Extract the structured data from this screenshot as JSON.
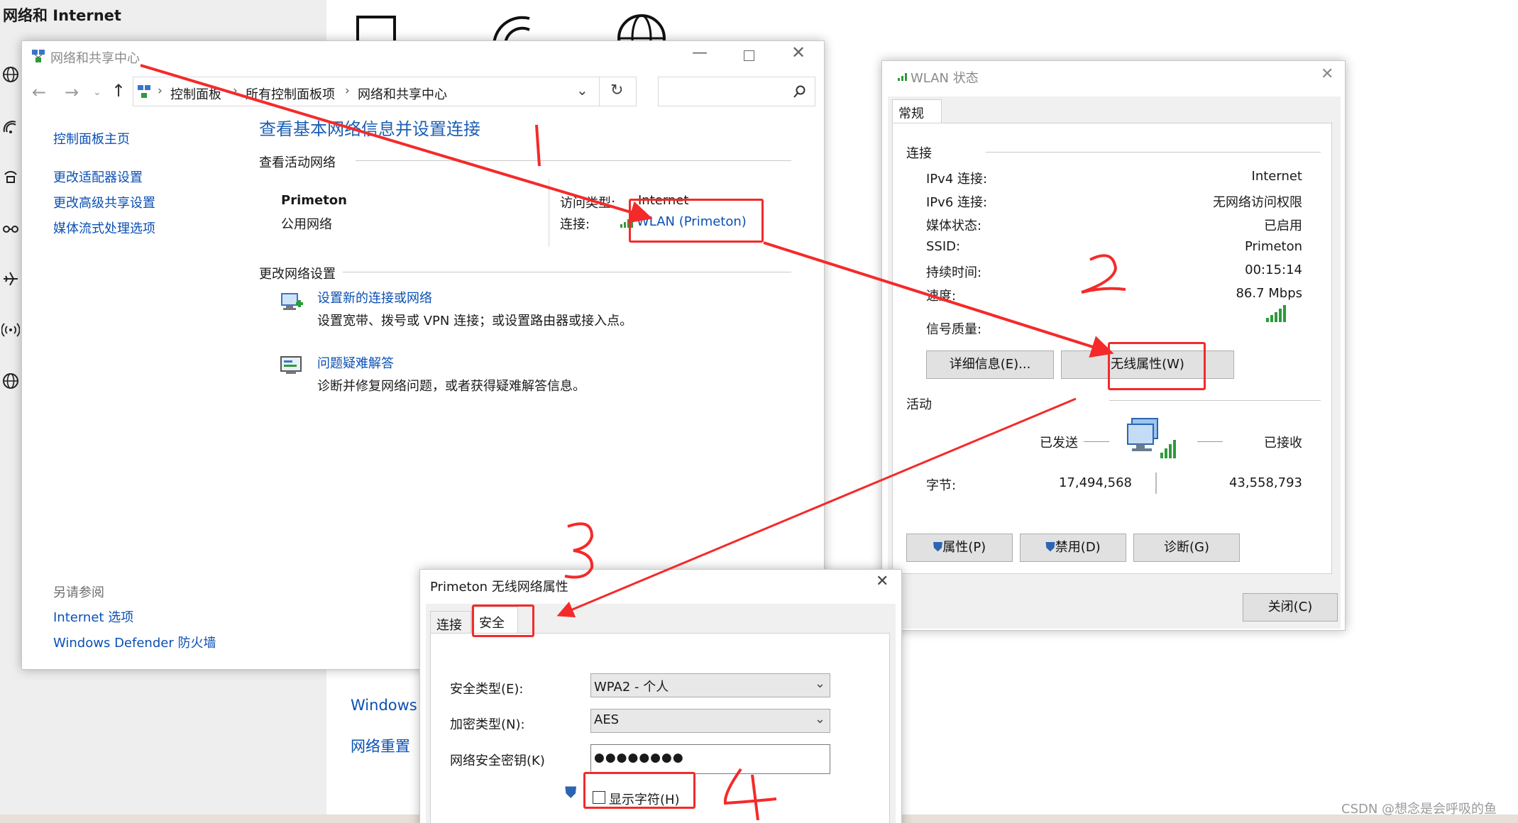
{
  "settings_app": {
    "title": "网络和 Internet",
    "links": {
      "windows_partial": "Windows 防",
      "network_reset": "网络重置"
    }
  },
  "ncsc": {
    "title": "网络和共享中心",
    "breadcrumb": [
      "控制面板",
      "所有控制面板项",
      "网络和共享中心"
    ],
    "sidebar": {
      "home": "控制面板主页",
      "items": [
        "更改适配器设置",
        "更改高级共享设置",
        "媒体流式处理选项"
      ],
      "see_also_title": "另请参阅",
      "see_also": [
        "Internet 选项",
        "Windows Defender 防火墙"
      ]
    },
    "heading": "查看基本网络信息并设置连接",
    "active_networks_label": "查看活动网络",
    "network_name": "Primeton",
    "network_type": "公用网络",
    "access_type_label": "访问类型:",
    "access_type_value": "Internet",
    "connection_label": "连接:",
    "connection_link": "WLAN (Primeton)",
    "change_settings_label": "更改网络设置",
    "tasks": [
      {
        "title": "设置新的连接或网络",
        "desc": "设置宽带、拨号或 VPN 连接；或设置路由器或接入点。"
      },
      {
        "title": "问题疑难解答",
        "desc": "诊断并修复网络问题，或者获得疑难解答信息。"
      }
    ]
  },
  "wlan_status": {
    "title": "WLAN 状态",
    "tab": "常规",
    "connection_section": "连接",
    "rows": [
      {
        "label": "IPv4 连接:",
        "value": "Internet"
      },
      {
        "label": "IPv6 连接:",
        "value": "无网络访问权限"
      },
      {
        "label": "媒体状态:",
        "value": "已启用"
      },
      {
        "label": "SSID:",
        "value": "Primeton"
      },
      {
        "label": "持续时间:",
        "value": "00:15:14"
      },
      {
        "label": "速度:",
        "value": "86.7 Mbps"
      }
    ],
    "signal_label": "信号质量:",
    "details_button": "详细信息(E)...",
    "wireless_props_button": "无线属性(W)",
    "activity_section": "活动",
    "sent_label": "已发送",
    "received_label": "已接收",
    "bytes_label": "字节:",
    "bytes_sent": "17,494,568",
    "bytes_received": "43,558,793",
    "props_button": "属性(P)",
    "disable_button": "禁用(D)",
    "diagnose_button": "诊断(G)",
    "close_button": "关闭(C)"
  },
  "wireless_props": {
    "title": "Primeton 无线网络属性",
    "tabs": [
      "连接",
      "安全"
    ],
    "security_type_label": "安全类型(E):",
    "security_type_value": "WPA2 - 个人",
    "encryption_type_label": "加密类型(N):",
    "encryption_type_value": "AES",
    "key_label": "网络安全密钥(K)",
    "key_value": "●●●●●●●●",
    "show_chars_label": "显示字符(H)"
  },
  "annotations": [
    "1",
    "2",
    "3",
    "4"
  ],
  "watermark": "CSDN @想念是会呼吸的鱼",
  "colors": {
    "annotation_red": "#f42a2a",
    "link_blue": "#0a50b4",
    "heading_blue": "#1e5fb4"
  }
}
